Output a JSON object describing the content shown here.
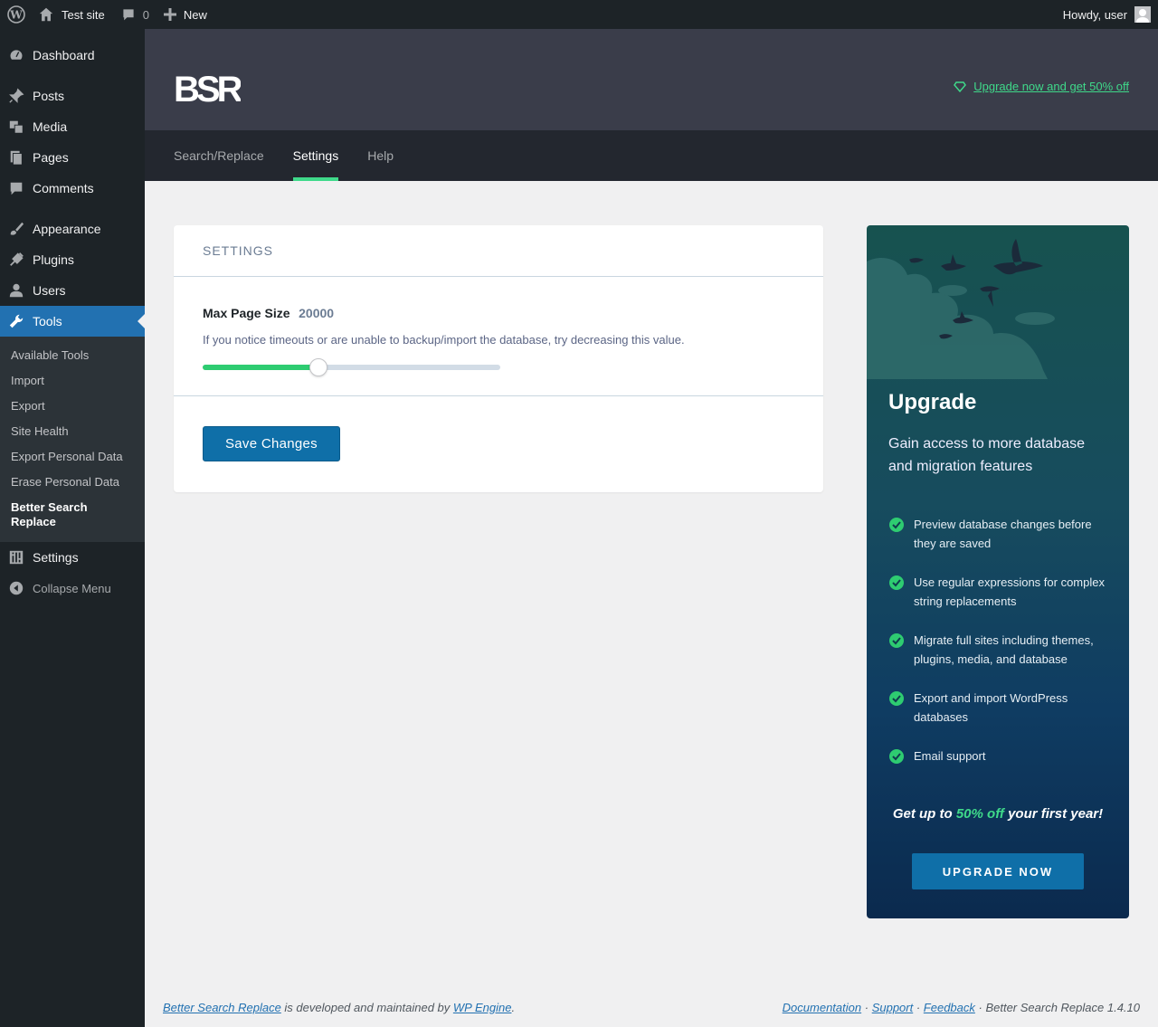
{
  "adminbar": {
    "site_name": "Test site",
    "comments_count": "0",
    "new_label": "New",
    "howdy": "Howdy, user"
  },
  "sidebar": {
    "items": [
      {
        "label": "Dashboard",
        "icon": "dashboard-icon"
      },
      {
        "label": "Posts",
        "icon": "pin-icon"
      },
      {
        "label": "Media",
        "icon": "media-icon"
      },
      {
        "label": "Pages",
        "icon": "pages-icon"
      },
      {
        "label": "Comments",
        "icon": "comment-icon"
      },
      {
        "label": "Appearance",
        "icon": "brush-icon"
      },
      {
        "label": "Plugins",
        "icon": "plug-icon"
      },
      {
        "label": "Users",
        "icon": "user-icon"
      },
      {
        "label": "Tools",
        "icon": "wrench-icon"
      },
      {
        "label": "Settings",
        "icon": "sliders-icon"
      }
    ],
    "submenu": [
      "Available Tools",
      "Import",
      "Export",
      "Site Health",
      "Export Personal Data",
      "Erase Personal Data",
      "Better Search Replace"
    ],
    "collapse_label": "Collapse Menu"
  },
  "header": {
    "logo_text": "BSR",
    "upgrade_link": "Upgrade now and get 50% off"
  },
  "tabs": [
    "Search/Replace",
    "Settings",
    "Help"
  ],
  "settings_card": {
    "title": "SETTINGS",
    "field_label": "Max Page Size",
    "field_value": "20000",
    "help_text": "If you notice timeouts or are unable to backup/import the database, try decreasing this value.",
    "slider_fraction": 0.39,
    "save_label": "Save Changes"
  },
  "upgrade_panel": {
    "title": "Upgrade",
    "subtitle": "Gain access to more database and migration features",
    "features": [
      "Preview database changes before they are saved",
      "Use regular expressions for complex string replacements",
      "Migrate full sites including themes, plugins, media, and database",
      "Export and import WordPress databases",
      "Email support"
    ],
    "offer_prefix": "Get up to ",
    "offer_highlight": "50% off",
    "offer_suffix": " your first year!",
    "button_label": "UPGRADE NOW"
  },
  "footer": {
    "plugin_link": "Better Search Replace",
    "developed_text": " is developed and maintained by ",
    "company_link": "WP Engine",
    "period": ".",
    "docs_link": "Documentation",
    "sep": " · ",
    "support_link": "Support",
    "feedback_link": "Feedback",
    "version_text": " · Better Search Replace 1.4.10"
  },
  "colors": {
    "accent_green": "#3fd98a",
    "wp_blue": "#2271b1",
    "button_blue": "#0f6fa8"
  }
}
